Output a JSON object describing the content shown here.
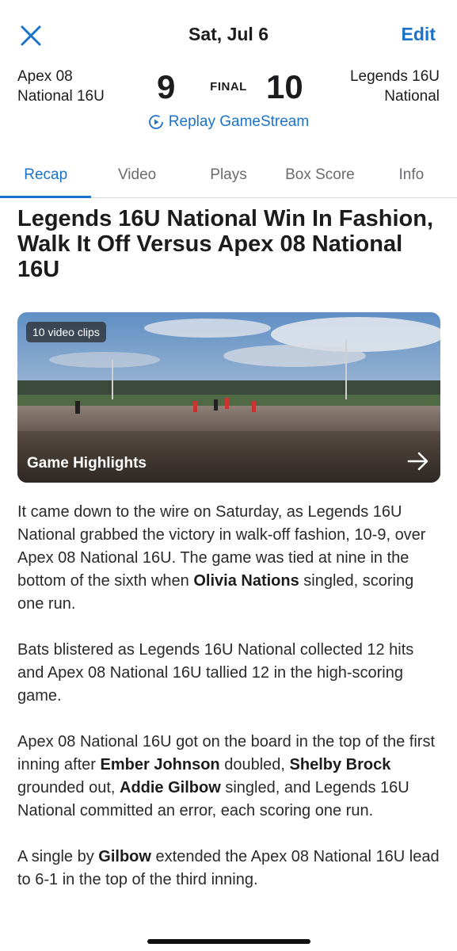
{
  "header": {
    "date": "Sat, Jul 6",
    "edit_label": "Edit"
  },
  "score": {
    "away_team_line1": "Apex 08",
    "away_team_line2": "National 16U",
    "away_score": "9",
    "status": "FINAL",
    "home_score": "10",
    "home_team_line1": "Legends 16U",
    "home_team_line2": "National",
    "replay_label": "Replay GameStream"
  },
  "tabs": [
    {
      "label": "Recap",
      "active": true
    },
    {
      "label": "Video",
      "active": false
    },
    {
      "label": "Plays",
      "active": false
    },
    {
      "label": "Box Score",
      "active": false
    },
    {
      "label": "Info",
      "active": false
    }
  ],
  "article": {
    "headline": "Legends 16U National Win In Fashion, Walk It Off Versus Apex 08 National 16U",
    "video": {
      "badge": "10 video clips",
      "title": "Game Highlights"
    },
    "p1": {
      "a": "It came down to the wire on Saturday, as Legends 16U National grabbed the victory in walk-off fashion, 10-9, over Apex 08 National 16U. The game was tied at nine in the bottom of the sixth when ",
      "b1": "Olivia Nations",
      "c": " singled, scoring one run."
    },
    "p2": "Bats blistered as Legends 16U National collected 12 hits and Apex 08 National 16U tallied 12 in the high-scoring game.",
    "p3": {
      "a": "Apex 08 National 16U got on the board in the top of the first inning after ",
      "b1": "Ember Johnson",
      "c": " doubled, ",
      "b2": "Shelby Brock",
      "d": " grounded out, ",
      "b3": "Addie Gilbow",
      "e": " singled, and Legends 16U National committed an error, each scoring one run."
    },
    "p4": {
      "a": "A single by ",
      "b1": "Gilbow",
      "c": " extended the Apex 08 National 16U lead to 6-1 in the top of the third inning."
    }
  },
  "colors": {
    "accent": "#1a73c9",
    "text": "#1c1c1e",
    "muted": "#6b6b70"
  }
}
